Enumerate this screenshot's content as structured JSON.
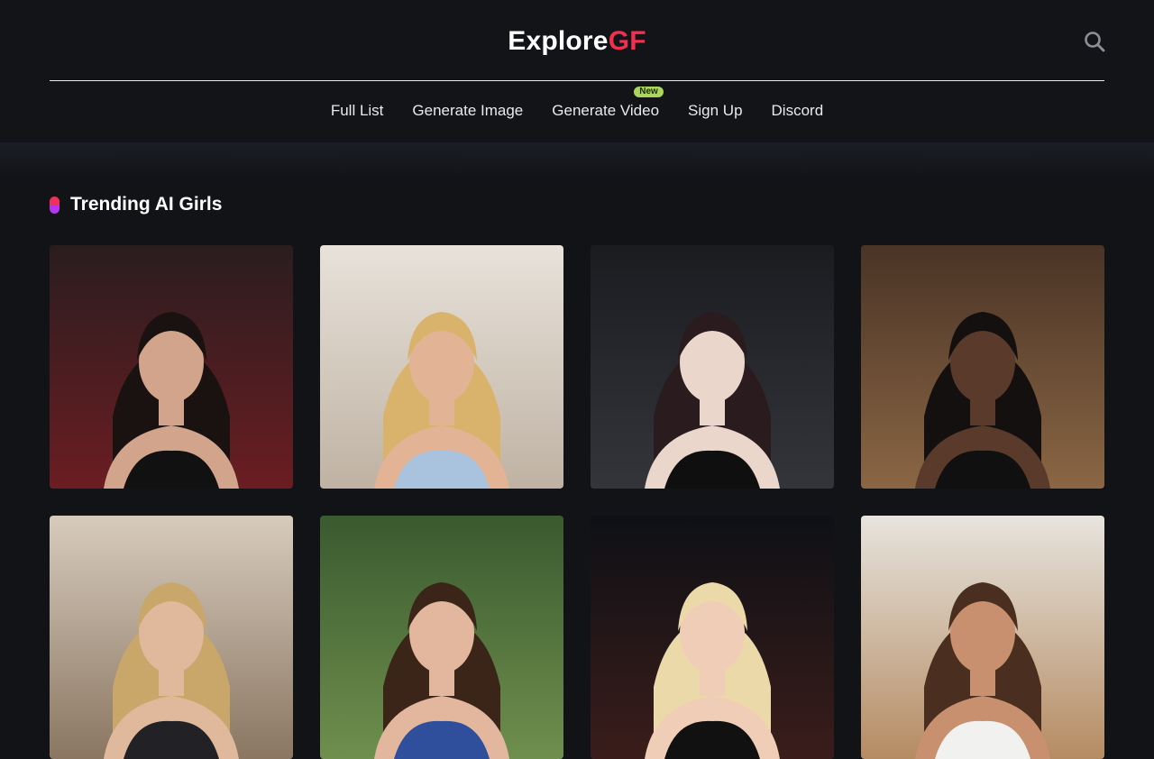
{
  "logo": {
    "part1": "Explore",
    "part2": "GF"
  },
  "header": {
    "search_icon": "search-icon"
  },
  "nav": {
    "items": [
      {
        "label": "Full List"
      },
      {
        "label": "Generate Image"
      },
      {
        "label": "Generate Video",
        "badge": "New"
      },
      {
        "label": "Sign Up"
      },
      {
        "label": "Discord"
      }
    ]
  },
  "section": {
    "title": "Trending AI Girls"
  },
  "colors": {
    "background": "#121317",
    "accent_red": "#f0304e",
    "accent_purple": "#b437ef",
    "badge_green": "#a9d65b"
  },
  "gallery": {
    "cards": [
      {
        "bg1": "#2a1d1f",
        "bg2": "#6b1d22",
        "skin": "#d3a48c",
        "hair": "#1a1210",
        "outfit": "#111111"
      },
      {
        "bg1": "#e8e2da",
        "bg2": "#bfb2a3",
        "skin": "#e2b394",
        "hair": "#d9b36c",
        "outfit": "#a9c3de"
      },
      {
        "bg1": "#1b1c20",
        "bg2": "#33353b",
        "skin": "#ead6cb",
        "hair": "#2a1c1e",
        "outfit": "#0f0f10"
      },
      {
        "bg1": "#4a3426",
        "bg2": "#8a6644",
        "skin": "#5a3a2a",
        "hair": "#141010",
        "outfit": "#101010"
      },
      {
        "bg1": "#d7cbbd",
        "bg2": "#8a7661",
        "skin": "#e0b89c",
        "hair": "#c9a76a",
        "outfit": "#222226"
      },
      {
        "bg1": "#3a5a2f",
        "bg2": "#6f8f4e",
        "skin": "#e3b79d",
        "hair": "#3a2518",
        "outfit": "#2f4f9c"
      },
      {
        "bg1": "#0e1016",
        "bg2": "#3a1d1a",
        "skin": "#f0cdb6",
        "hair": "#ecd9a9",
        "outfit": "#111111"
      },
      {
        "bg1": "#e7e4de",
        "bg2": "#b58b62",
        "skin": "#c8906e",
        "hair": "#4a2e1f",
        "outfit": "#f1f1f0"
      }
    ]
  }
}
